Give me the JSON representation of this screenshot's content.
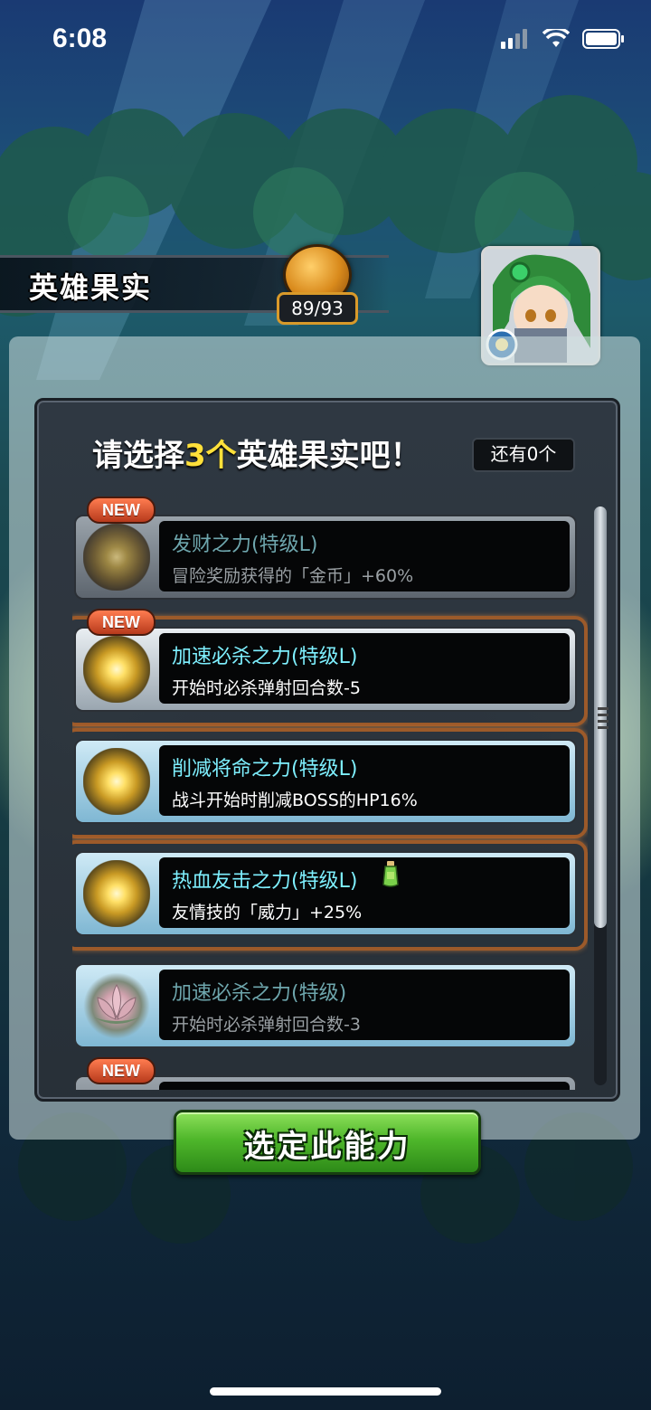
{
  "status_bar": {
    "time": "6:08"
  },
  "header": {
    "title": "英雄果实",
    "fruit_count": "89/93"
  },
  "prompt": {
    "before": "请选择",
    "highlight": "3个",
    "after": "英雄果实吧！",
    "remaining": "还有0个"
  },
  "new_badge_label": "NEW",
  "rows": [
    {
      "title": "发财之力(特级L)",
      "desc": "冒险奖励获得的「金币」+60%",
      "is_new": true,
      "selected": false,
      "dimmed": true
    },
    {
      "title": "加速必杀之力(特级L)",
      "desc": "开始时必杀弹射回合数-5",
      "is_new": true,
      "selected": true,
      "dimmed": false
    },
    {
      "title": "削减将命之力(特级L)",
      "desc": "战斗开始时削减BOSS的HP16%",
      "is_new": false,
      "selected": true,
      "dimmed": false
    },
    {
      "title": "热血友击之力(特级L)",
      "desc": "友情技的「威力」+25%",
      "is_new": false,
      "selected": true,
      "dimmed": false
    },
    {
      "title": "加速必杀之力(特级)",
      "desc": "开始时必杀弹射回合数-3",
      "is_new": false,
      "selected": false,
      "dimmed": true
    },
    {
      "title": "",
      "desc": "",
      "is_new": true,
      "selected": false,
      "dimmed": true
    }
  ],
  "select_button": {
    "label": "选定此能力"
  },
  "colors": {
    "accent_yellow": "#ffe03a",
    "title_cyan": "#7ef0ff",
    "button_green": "#4fb72b",
    "selected_border": "#9c5a2a"
  }
}
